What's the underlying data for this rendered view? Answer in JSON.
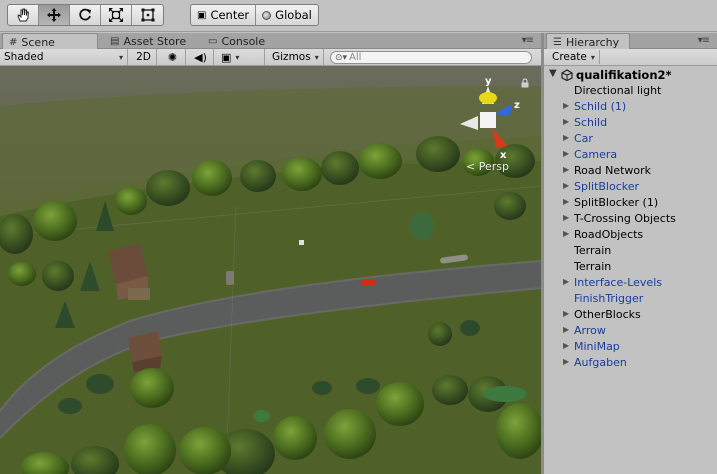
{
  "toolbar": {
    "transform_tools": [
      {
        "name": "hand-tool",
        "icon": "hand-icon",
        "active": false
      },
      {
        "name": "move-tool",
        "icon": "move-arrows-icon",
        "active": true
      },
      {
        "name": "rotate-tool",
        "icon": "rotate-icon",
        "active": false
      },
      {
        "name": "scale-tool",
        "icon": "scale-icon",
        "active": false
      },
      {
        "name": "rect-tool",
        "icon": "rect-transform-icon",
        "active": false
      }
    ],
    "pivot_label": "Center",
    "space_label": "Global"
  },
  "scene_tabs": {
    "scene": "Scene",
    "asset_store": "Asset Store",
    "console": "Console"
  },
  "scene_bar": {
    "shading_mode": "Shaded",
    "mode_2d": "2D",
    "gizmos": "Gizmos",
    "search_placeholder": "All"
  },
  "scene_view": {
    "gizmo_axes": {
      "y": "y",
      "z": "z",
      "x": "x"
    },
    "projection": "Persp"
  },
  "hierarchy": {
    "tab_label": "Hierarchy",
    "create_label": "Create",
    "scene_name": "qualifikation2*",
    "items": [
      {
        "label": "Directional light",
        "expandable": false,
        "prefab": false
      },
      {
        "label": "Schild (1)",
        "expandable": true,
        "prefab": true
      },
      {
        "label": "Schild",
        "expandable": true,
        "prefab": true
      },
      {
        "label": "Car",
        "expandable": true,
        "prefab": true
      },
      {
        "label": "Camera",
        "expandable": true,
        "prefab": true
      },
      {
        "label": "Road Network",
        "expandable": true,
        "prefab": false
      },
      {
        "label": "SplitBlocker",
        "expandable": true,
        "prefab": true
      },
      {
        "label": "SplitBlocker (1)",
        "expandable": true,
        "prefab": false
      },
      {
        "label": "T-Crossing Objects",
        "expandable": true,
        "prefab": false
      },
      {
        "label": "RoadObjects",
        "expandable": true,
        "prefab": false
      },
      {
        "label": "Terrain",
        "expandable": false,
        "prefab": false
      },
      {
        "label": "Terrain",
        "expandable": false,
        "prefab": false
      },
      {
        "label": "Interface-Levels",
        "expandable": true,
        "prefab": true
      },
      {
        "label": "FinishTrigger",
        "expandable": false,
        "prefab": true
      },
      {
        "label": "OtherBlocks",
        "expandable": true,
        "prefab": false
      },
      {
        "label": "Arrow",
        "expandable": true,
        "prefab": true
      },
      {
        "label": "MiniMap",
        "expandable": true,
        "prefab": true
      },
      {
        "label": "Aufgaben",
        "expandable": true,
        "prefab": true
      }
    ]
  },
  "colors": {
    "prefab_text": "#1a3c9c",
    "panel_bg": "#c2c2c2",
    "terrain": "#56682e",
    "road": "#5b5d5c"
  }
}
